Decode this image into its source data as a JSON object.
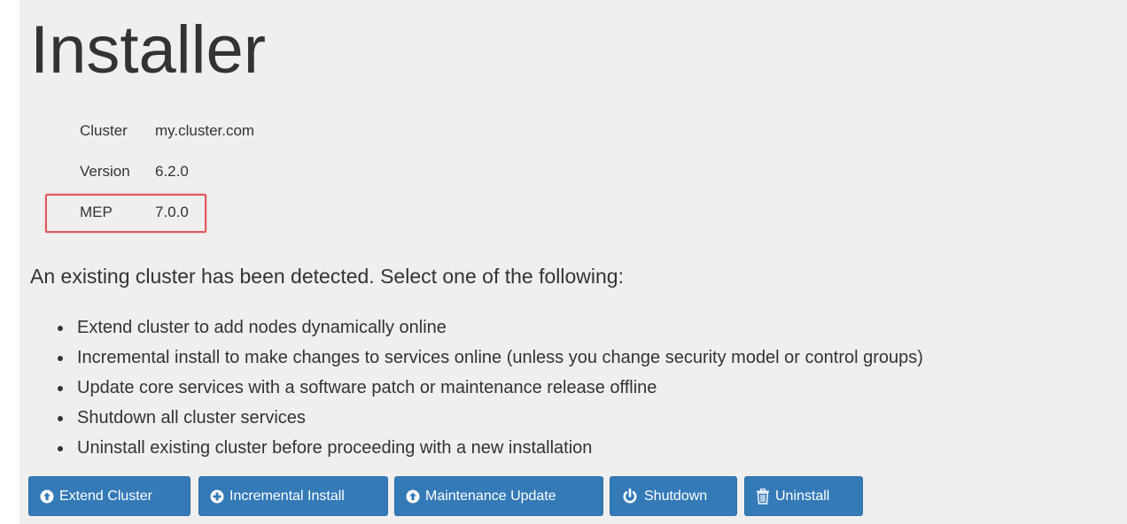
{
  "page": {
    "title": "Installer"
  },
  "cluster_info": [
    {
      "key": "Cluster",
      "value": "my.cluster.com"
    },
    {
      "key": "Version",
      "value": "6.2.0"
    },
    {
      "key": "MEP",
      "value": "7.0.0"
    }
  ],
  "highlight": {
    "color": "#e0575a",
    "target": "MEP"
  },
  "prompt": "An existing cluster has been detected. Select one of the following:",
  "options": [
    "Extend cluster to add nodes dynamically online",
    "Incremental install to make changes to services online (unless you change security model or control groups)",
    "Update core services with a software patch or maintenance release offline",
    "Shutdown all cluster services",
    "Uninstall existing cluster before proceeding with a new installation"
  ],
  "buttons": [
    {
      "label": "Extend Cluster",
      "icon": "arrow-up-circle-icon"
    },
    {
      "label": "Incremental Install",
      "icon": "plus-circle-icon"
    },
    {
      "label": "Maintenance Update",
      "icon": "arrow-up-circle-icon"
    },
    {
      "label": "Shutdown",
      "icon": "power-icon"
    },
    {
      "label": "Uninstall",
      "icon": "trash-icon"
    }
  ],
  "colors": {
    "primary_button": "#337ab7",
    "background": "#efefef",
    "text": "#333333"
  }
}
